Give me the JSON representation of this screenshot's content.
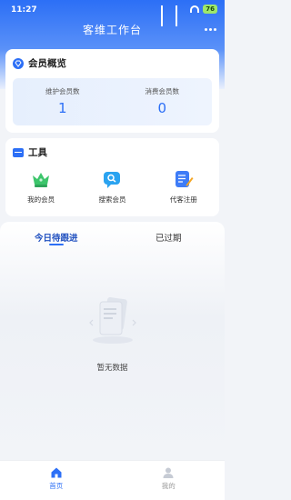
{
  "status_bar": {
    "time": "11:27",
    "indicators": "ℕ✇ ᵢₗ ᵢₗ",
    "battery": "76"
  },
  "header": {
    "title": "客维工作台"
  },
  "overview": {
    "title": "会员概览",
    "stats": [
      {
        "label": "维护会员数",
        "value": "1"
      },
      {
        "label": "消费会员数",
        "value": "0"
      }
    ]
  },
  "tools": {
    "title": "工具",
    "items": [
      {
        "label": "我的会员",
        "icon": "crown-icon"
      },
      {
        "label": "搜索会员",
        "icon": "search-chat-icon"
      },
      {
        "label": "代客注册",
        "icon": "edit-form-icon"
      }
    ]
  },
  "tabs": [
    {
      "label": "今日待跟进"
    },
    {
      "label": "已过期"
    }
  ],
  "empty_state": {
    "text": "暂无数据"
  },
  "tabbar": [
    {
      "label": "首页"
    },
    {
      "label": "我的"
    }
  ],
  "colors": {
    "accent": "#2c6ff6",
    "header_gradient_top": "#2c6ff6",
    "tool_crown": "#3cc56b",
    "tool_search": "#2aa3f0",
    "tool_edit": "#3e7cf7"
  }
}
